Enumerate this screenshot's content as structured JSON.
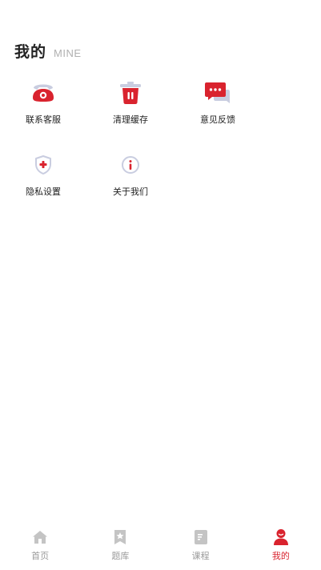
{
  "header": {
    "title": "我的",
    "subtitle": "MINE"
  },
  "menu": {
    "items": [
      {
        "label": "联系客服",
        "icon": "phone-icon"
      },
      {
        "label": "清理缓存",
        "icon": "trash-icon"
      },
      {
        "label": "意见反馈",
        "icon": "feedback-chat-icon"
      },
      {
        "label": "隐私设置",
        "icon": "privacy-shield-icon"
      },
      {
        "label": "关于我们",
        "icon": "info-icon"
      }
    ]
  },
  "tabbar": {
    "tabs": [
      {
        "label": "首页",
        "icon": "home-icon",
        "active": false
      },
      {
        "label": "题库",
        "icon": "question-bank-icon",
        "active": false
      },
      {
        "label": "课程",
        "icon": "course-icon",
        "active": false
      },
      {
        "label": "我的",
        "icon": "profile-icon",
        "active": true
      }
    ]
  },
  "colors": {
    "accent": "#d9232e",
    "icon_secondary": "#c9cde0",
    "tab_inactive": "#c4c4c4",
    "text": "#222222"
  }
}
